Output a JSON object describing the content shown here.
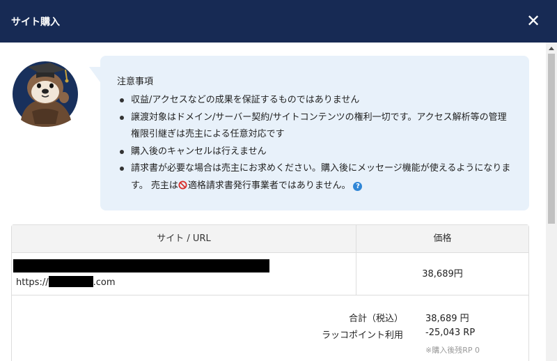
{
  "header": {
    "title": "サイト購入",
    "close_symbol": "✕"
  },
  "notice": {
    "title": "注意事項",
    "items": [
      "収益/アクセスなどの成果を保証するものではありません",
      "譲渡対象はドメイン/サーバー契約/サイトコンテンツの権利一切です。アクセス解析等の管理権限引継ぎは売主による任意対応です",
      "購入後のキャンセルは行えません"
    ],
    "item4_text": "請求書が必要な場合は売主にお求めください。購入後にメッセージ機能が使えるようになります。 売主は",
    "item4_ban_text": "適格請求書発行事業者ではありません。",
    "help_symbol": "?"
  },
  "table": {
    "headers": {
      "site": "サイト / URL",
      "price": "価格"
    },
    "row": {
      "url_prefix": "https://",
      "url_suffix": ".com",
      "price": "38,689円"
    },
    "summary": {
      "total_label": "合計（税込）",
      "total_value": "38,689 円",
      "points_label": "ラッコポイント利用",
      "points_value": "-25,043 RP",
      "note": "※購入後残RP 0"
    }
  },
  "colors": {
    "header_bg": "#172a54",
    "bubble_bg": "#e8f1fa",
    "help_icon": "#2f86d6",
    "ban_icon": "#d9302c"
  }
}
